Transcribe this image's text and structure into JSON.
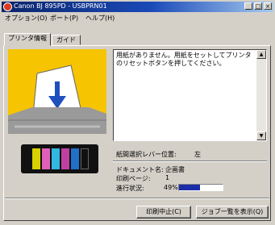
{
  "window": {
    "title": "Canon BJ 895PD - USBPRN01",
    "min_label": "_",
    "max_label": "□",
    "close_label": "×"
  },
  "menu": [
    "オプション(O)",
    "ポート(P)",
    "ヘルプ(H)"
  ],
  "tabs": [
    {
      "label": "プリンタ情報",
      "active": true
    },
    {
      "label": "ガイド",
      "active": false
    }
  ],
  "message": "用紙がありません。用紙をセットしてプリンタのリセットボタンを押してください。",
  "lever": {
    "label": "紙間選択レバー位置:",
    "value": "左"
  },
  "document": {
    "label": "ドキュメント名:",
    "value": "企画書"
  },
  "page": {
    "label": "印刷ページ:",
    "value": "1"
  },
  "progress": {
    "label": "進行状況:",
    "text": "49%",
    "percent": 49
  },
  "buttons": {
    "cancel": "印刷中止(C)",
    "queue": "ジョブ一覧を表示(Q)"
  },
  "ink_colors": [
    "#d8d000",
    "#e060b8",
    "#30b8e0",
    "#c040a0",
    "#2070c8",
    "#101010"
  ],
  "colors": {
    "illustration_bg": "#f6c400",
    "progress_fill": "#1a2ea8"
  }
}
